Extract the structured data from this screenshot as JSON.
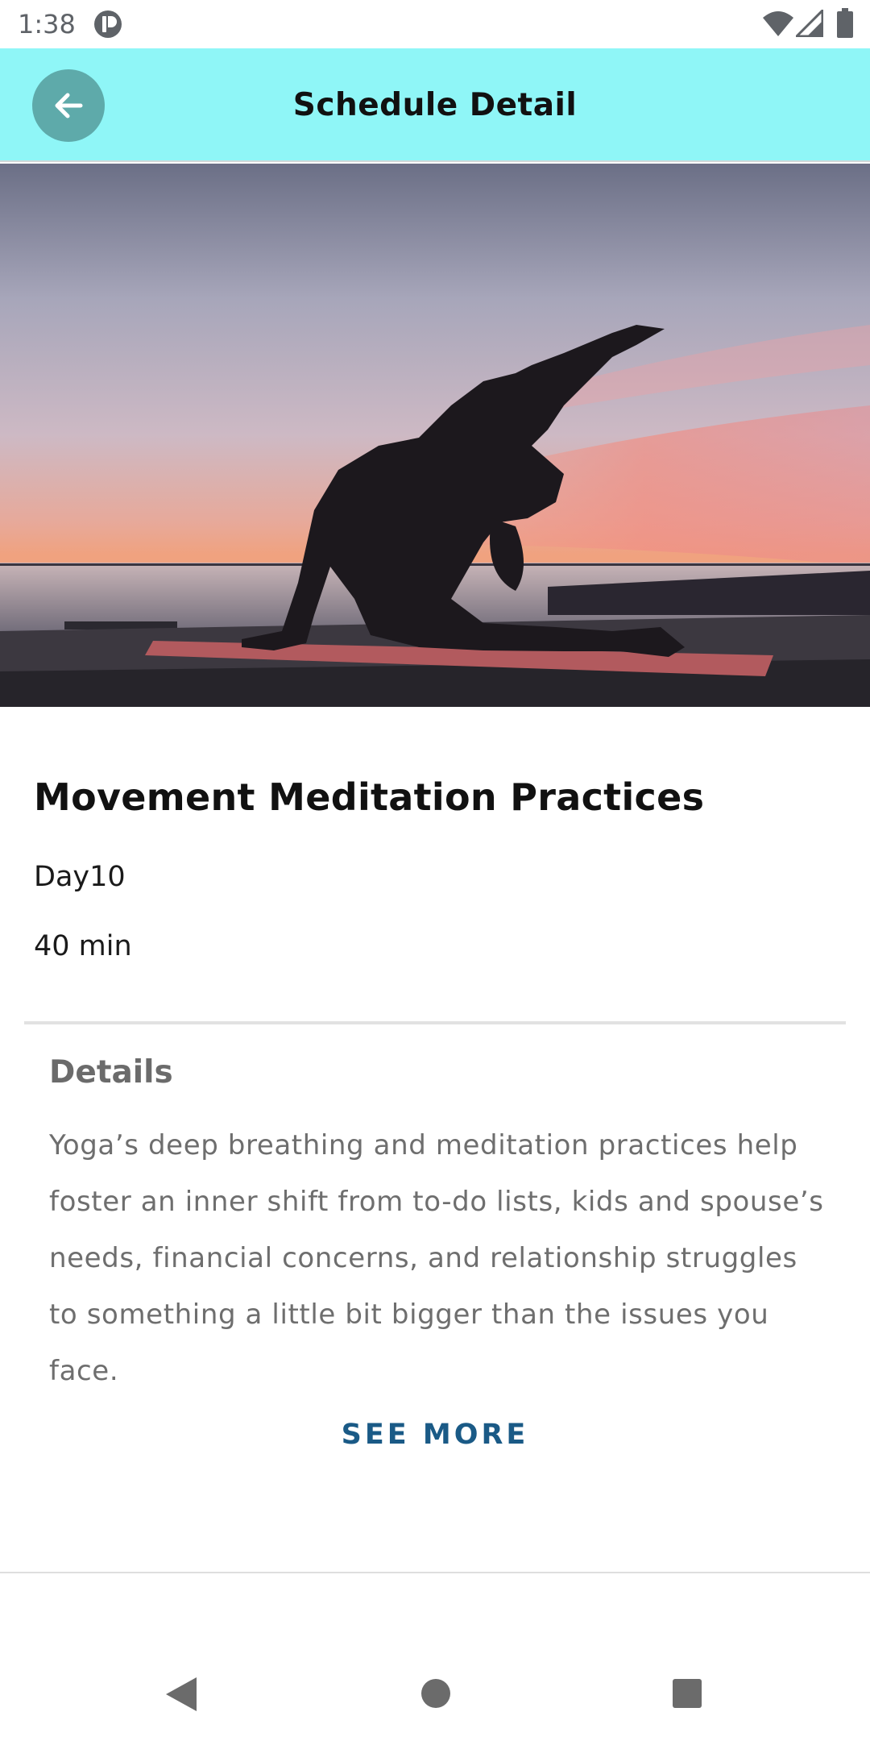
{
  "status_bar": {
    "time": "1:38",
    "icons": [
      "app-notification-icon",
      "wifi-icon",
      "signal-icon",
      "battery-icon"
    ]
  },
  "app_bar": {
    "title": "Schedule Detail",
    "back_icon": "arrow-left-icon",
    "background_color": "#8ff6f7",
    "back_button_color": "#5eaaaa"
  },
  "hero_image": {
    "icon": "yoga-sunset-image"
  },
  "workout": {
    "title": "Movement Meditation Practices",
    "day": "Day10",
    "duration": "40 min"
  },
  "details": {
    "heading": "Details",
    "body": "Yoga’s deep breathing and meditation practices help foster an inner shift from to-do lists, kids and spouse’s needs, financial concerns, and relationship struggles to something a little bit bigger than the issues you face.",
    "see_more_label": "SEE MORE",
    "see_more_color": "#1a5a86"
  },
  "nav_bar": {
    "icons": [
      "nav-back-icon",
      "nav-home-icon",
      "nav-recents-icon"
    ]
  }
}
